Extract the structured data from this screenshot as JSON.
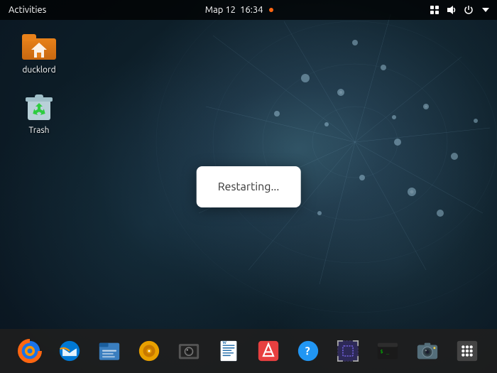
{
  "topbar": {
    "activities_label": "Activities",
    "app_name": "Map 12",
    "time": "16:34",
    "has_notification_dot": true
  },
  "desktop_icons": [
    {
      "id": "home-folder",
      "label": "ducklord",
      "type": "home"
    },
    {
      "id": "trash",
      "label": "Trash",
      "type": "trash"
    }
  ],
  "restart_dialog": {
    "text": "Restarting..."
  },
  "taskbar": {
    "apps": [
      {
        "id": "firefox",
        "label": "Firefox",
        "icon_type": "firefox"
      },
      {
        "id": "thunderbird",
        "label": "Thunderbird",
        "icon_type": "thunderbird"
      },
      {
        "id": "files",
        "label": "Files",
        "icon_type": "files"
      },
      {
        "id": "rhythmbox",
        "label": "Rhythmbox",
        "icon_type": "rhythmbox"
      },
      {
        "id": "shotwell",
        "label": "Shotwell",
        "icon_type": "shotwell"
      },
      {
        "id": "writer",
        "label": "LibreOffice Writer",
        "icon_type": "writer"
      },
      {
        "id": "software",
        "label": "Software Center",
        "icon_type": "software"
      },
      {
        "id": "help",
        "label": "Help",
        "icon_type": "help"
      },
      {
        "id": "screenshot",
        "label": "Screenshot",
        "icon_type": "screenshot"
      },
      {
        "id": "terminal",
        "label": "Terminal",
        "icon_type": "terminal"
      },
      {
        "id": "camera",
        "label": "Camera",
        "icon_type": "camera"
      },
      {
        "id": "apps",
        "label": "Show Apps",
        "icon_type": "apps"
      }
    ]
  }
}
